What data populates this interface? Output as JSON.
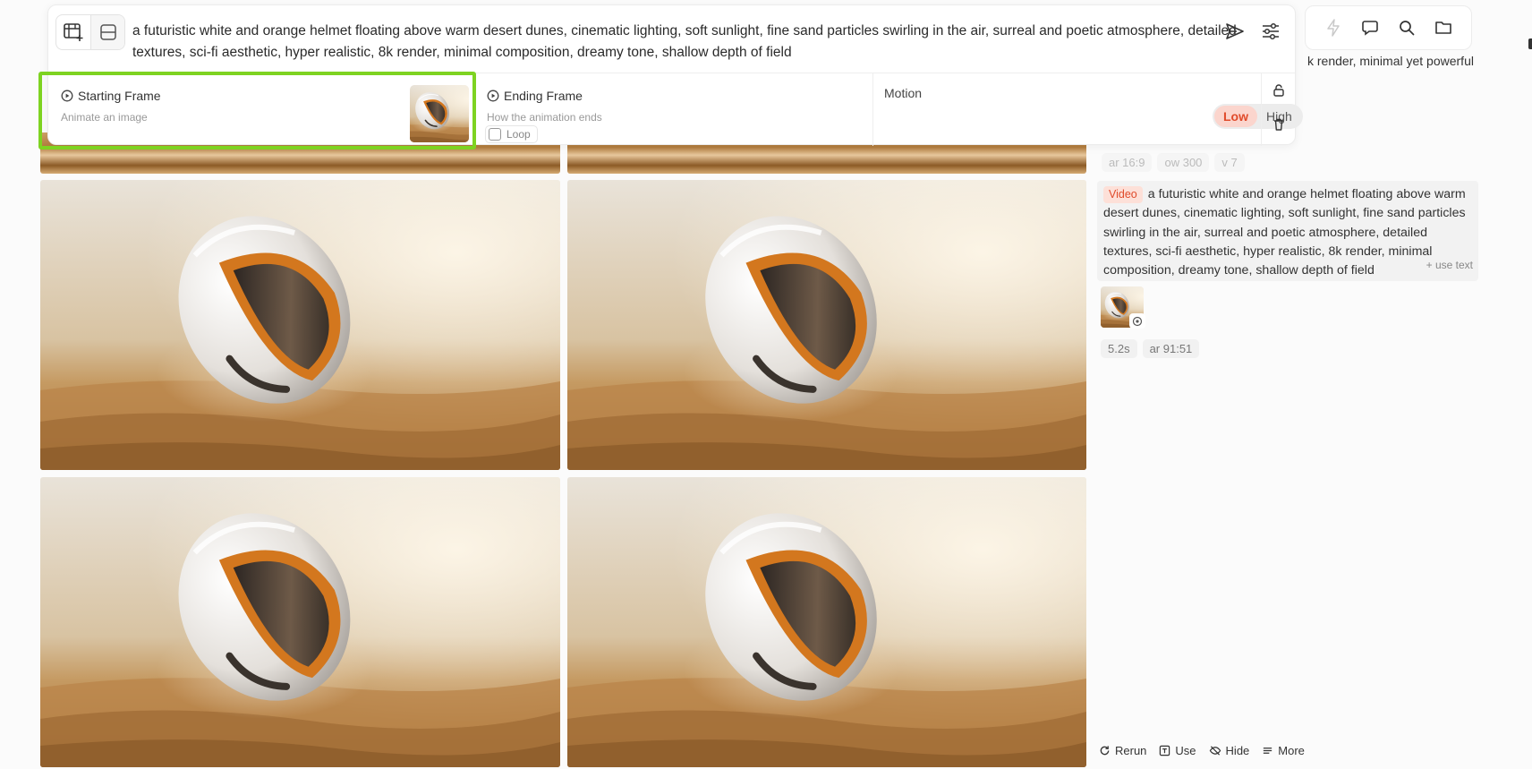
{
  "prompt": {
    "text": "a futuristic white and orange helmet floating above warm desert dunes, cinematic lighting, soft sunlight, fine sand particles swirling in the air, surreal and poetic atmosphere, detailed textures, sci-fi aesthetic, hyper realistic, 8k render, minimal composition, dreamy tone, shallow depth of field"
  },
  "frames": {
    "starting": {
      "title": "Starting Frame",
      "subtitle": "Animate an image"
    },
    "ending": {
      "title": "Ending Frame",
      "subtitle": "How the animation ends",
      "loop_label": "Loop",
      "loop_checked": false
    },
    "motion": {
      "title": "Motion",
      "options": [
        "Low",
        "High"
      ],
      "selected": "Low"
    }
  },
  "right_panel": {
    "overflow_text": "k render, minimal yet powerful",
    "prev_tags": [
      "ar 16:9",
      "ow 300",
      "v 7"
    ],
    "video_badge": "Video",
    "video_prompt": "a futuristic white and orange helmet floating above warm desert dunes, cinematic lighting, soft sunlight, fine sand particles swirling in the air, surreal and poetic atmosphere, detailed textures, sci-fi aesthetic, hyper realistic, 8k render, minimal composition, dreamy tone, shallow depth of field",
    "use_text": "+ use text",
    "meta_tags": [
      "5.2s",
      "ar 91:51"
    ]
  },
  "actions": {
    "rerun": "Rerun",
    "use": "Use",
    "hide": "Hide",
    "more": "More"
  },
  "colors": {
    "highlight": "#7ed321",
    "accent": "#e04b2b"
  }
}
